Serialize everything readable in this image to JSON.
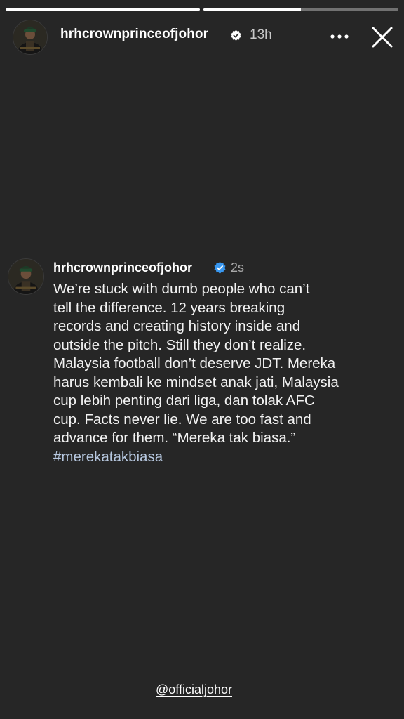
{
  "story": {
    "segments": [
      {
        "progress": 1.0
      },
      {
        "progress": 0.5
      }
    ]
  },
  "header": {
    "username": "hrhcrownprinceofjohor",
    "verified": true,
    "time": "13h",
    "more_icon": "more-horizontal-icon",
    "close_icon": "close-icon"
  },
  "post": {
    "username": "hrhcrownprinceofjohor",
    "verified": true,
    "time": "2s",
    "lines": [
      "We’re stuck with dumb people who can’t",
      "tell the difference. 12 years breaking",
      "records and creating history inside and",
      "outside the pitch. Still they don’t realize.",
      "Malaysia football don’t deserve JDT. Mereka",
      "harus kembali ke mindset anak jati, Malaysia",
      "cup lebih penting dari liga, dan tolak AFC",
      "cup. Facts never lie. We are too fast and",
      "advance for them. “Mereka tak biasa.”"
    ],
    "hashtag": "#merekatakbiasa"
  },
  "mention": "@officialjohor",
  "colors": {
    "background": "#262626",
    "verified_blue": "#3897f0",
    "hashtag": "#b7c8e0"
  }
}
